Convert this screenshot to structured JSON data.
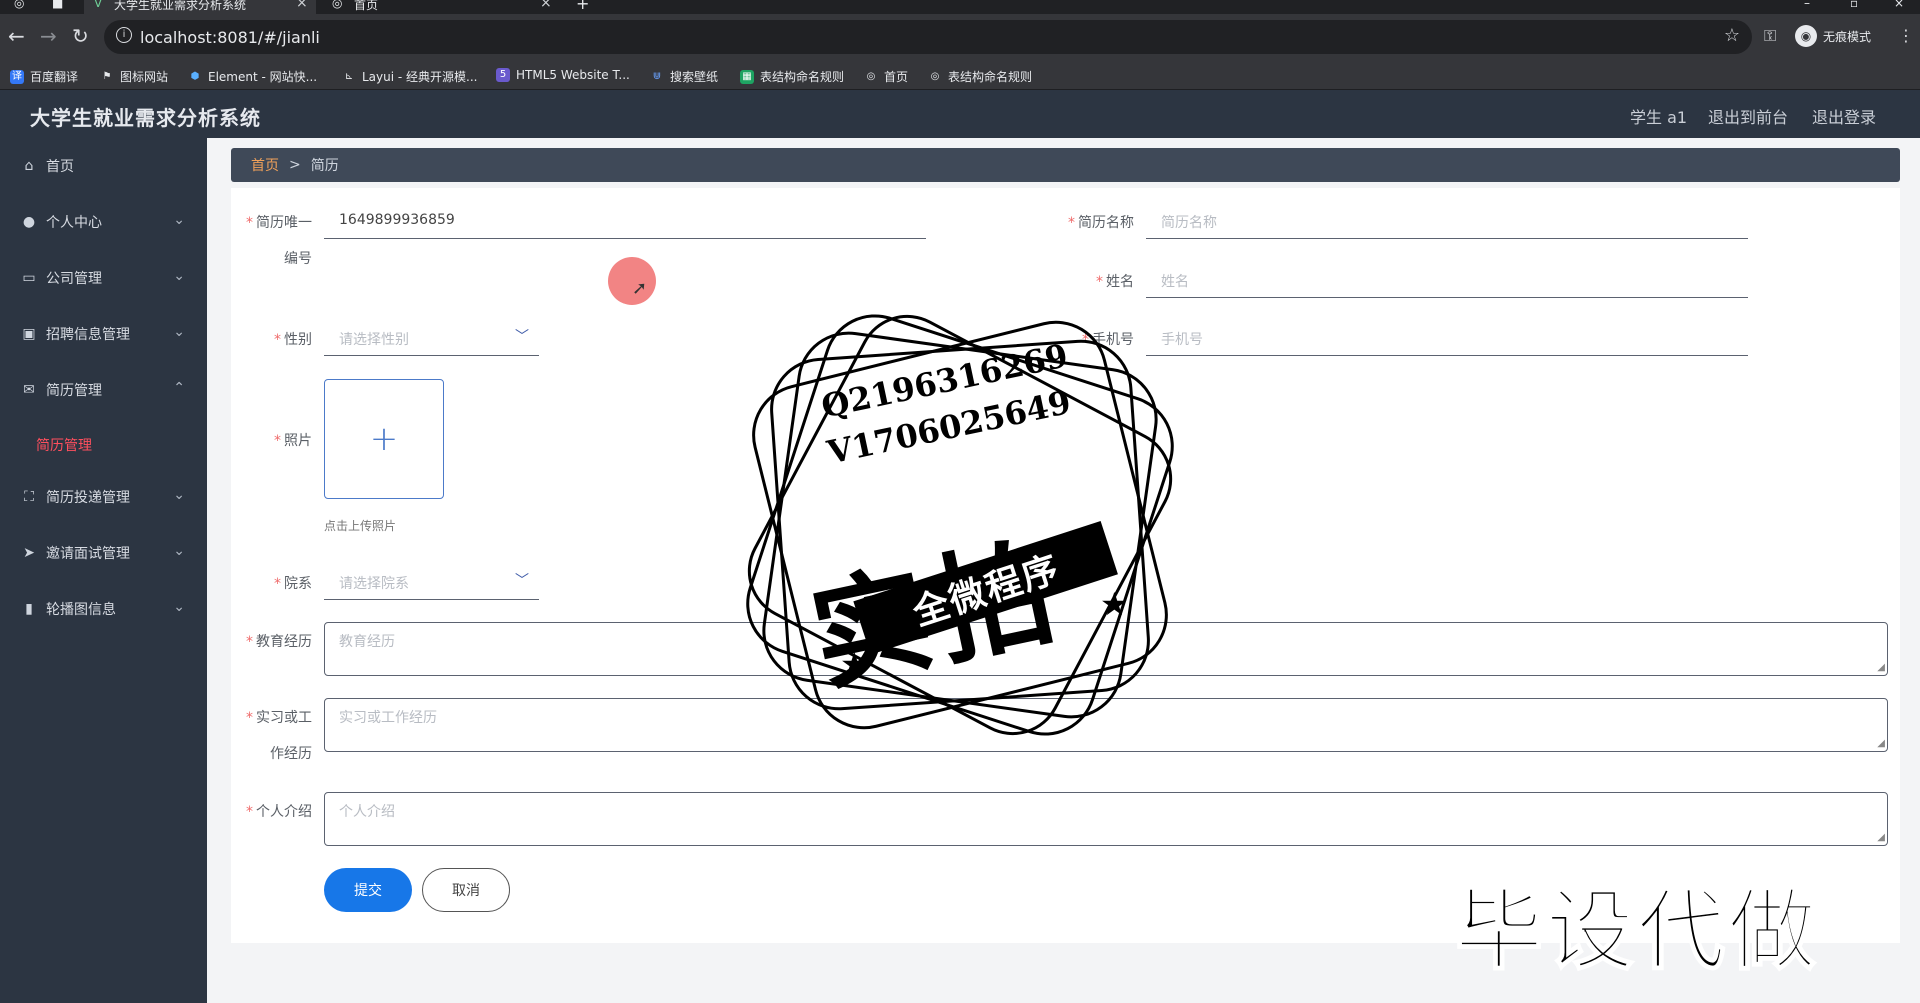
{
  "browser": {
    "tabs": [
      {
        "title": "大学生就业需求分析系统",
        "active": true
      },
      {
        "title": "首页",
        "active": false
      }
    ],
    "url": "localhost:8081/#/jianli",
    "incognito_label": "无痕模式",
    "bookmarks": [
      "百度翻译",
      "图标网站",
      "Element - 网站快...",
      "Layui - 经典开源模...",
      "HTML5 Website T...",
      "搜索壁纸",
      "表结构命名规则",
      "首页",
      "表结构命名规则"
    ]
  },
  "header": {
    "title": "大学生就业需求分析系统",
    "user": "学生 a1",
    "to_front": "退出到前台",
    "logout": "退出登录"
  },
  "sidebar": {
    "items": [
      {
        "label": "首页",
        "icon": "home-icon"
      },
      {
        "label": "个人中心",
        "icon": "user-icon"
      },
      {
        "label": "公司管理",
        "icon": "company-icon"
      },
      {
        "label": "招聘信息管理",
        "icon": "briefcase-icon"
      },
      {
        "label": "简历管理",
        "icon": "mail-icon"
      },
      {
        "label": "简历投递管理",
        "icon": "scan-icon"
      },
      {
        "label": "邀请面试管理",
        "icon": "send-icon"
      },
      {
        "label": "轮播图信息",
        "icon": "bar-chart-icon"
      }
    ],
    "active_sub": "简历管理"
  },
  "breadcrumb": {
    "home": "首页",
    "separator": ">",
    "current": "简历"
  },
  "form": {
    "resume_id": {
      "label_line1": "简历唯一",
      "label_line2": "编号",
      "value": "1649899936859"
    },
    "resume_name": {
      "label": "简历名称",
      "placeholder": "简历名称"
    },
    "name": {
      "label": "姓名",
      "placeholder": "姓名"
    },
    "gender": {
      "label": "性别",
      "placeholder": "请选择性别"
    },
    "phone": {
      "label": "手机号",
      "placeholder": "手机号"
    },
    "photo": {
      "label": "照片",
      "hint": "点击上传照片"
    },
    "department": {
      "label": "院系",
      "placeholder": "请选择院系"
    },
    "education": {
      "label": "教育经历",
      "placeholder": "教育经历"
    },
    "work": {
      "label_line1": "实习或工",
      "label_line2": "作经历",
      "placeholder": "实习或工作经历"
    },
    "intro": {
      "label": "个人介绍",
      "placeholder": "个人介绍"
    },
    "submit": "提交",
    "cancel": "取消"
  },
  "watermark": {
    "contact_q": "Q2196316269",
    "contact_v": "V1706025649",
    "big_text": "实拍",
    "band_text": "全微程序",
    "corner_text": "毕设代做"
  }
}
